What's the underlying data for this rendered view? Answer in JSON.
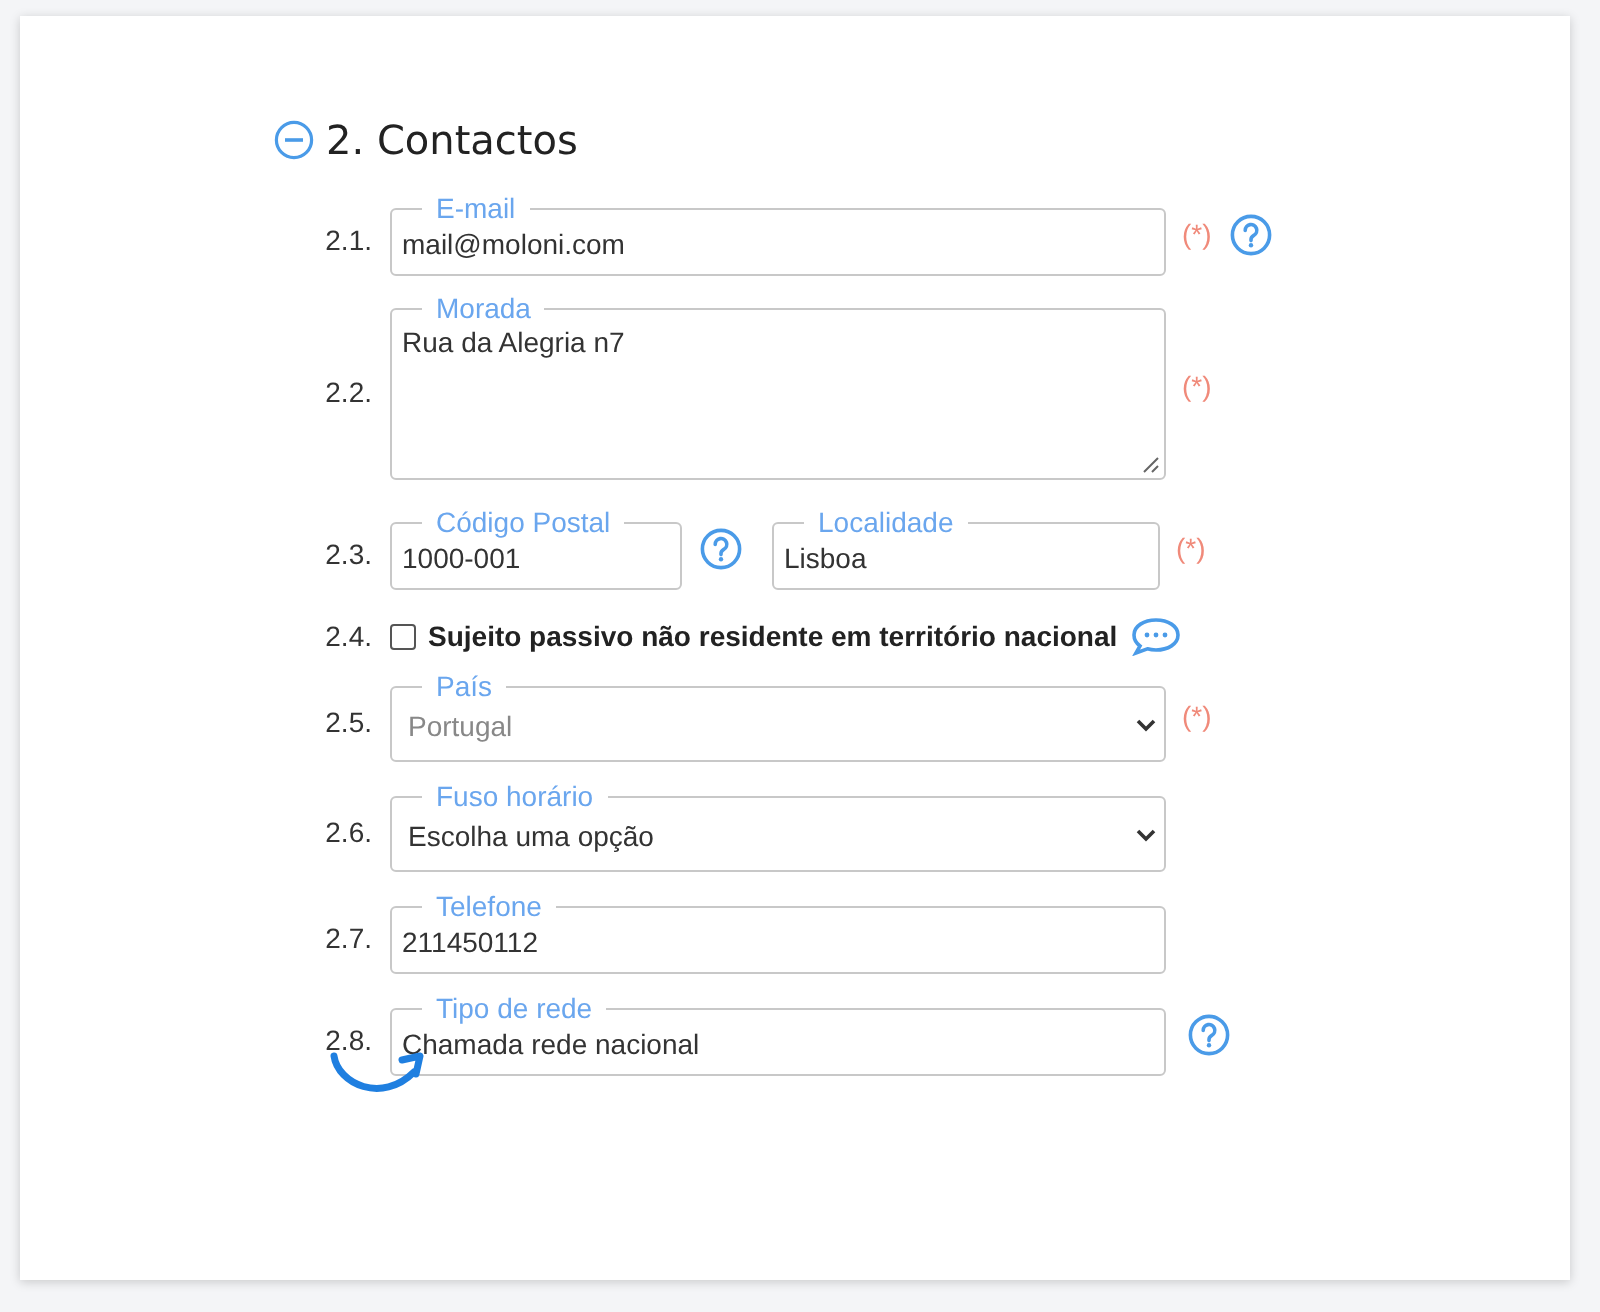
{
  "section": {
    "title": "2. Contactos",
    "expanded": true
  },
  "rows": [
    {
      "kind": "input",
      "number": "2.1.",
      "label": "E-mail",
      "value": "mail@moloni.com",
      "required": "(*)",
      "help": true
    },
    {
      "kind": "textarea",
      "number": "2.2.",
      "label": "Morada",
      "value": "Rua da Alegria n7",
      "required": "(*)",
      "help": false
    },
    {
      "kind": "pair",
      "number": "2.3.",
      "label": "Código Postal",
      "value": "1000-001",
      "help": true,
      "second": {
        "label": "Localidade",
        "value": "Lisboa"
      },
      "required": "(*)"
    },
    {
      "kind": "checkbox",
      "number": "2.4.",
      "label": "Sujeito passivo não residente em território nacional",
      "checked": false,
      "comment": true
    },
    {
      "kind": "select",
      "number": "2.5.",
      "label": "País",
      "value": "Portugal",
      "disabled": true,
      "required": "(*)",
      "help": false
    },
    {
      "kind": "select",
      "number": "2.6.",
      "label": "Fuso horário",
      "value": "Escolha uma opção",
      "disabled": false,
      "help": false
    },
    {
      "kind": "input",
      "number": "2.7.",
      "label": "Telefone",
      "value": "211450112",
      "help": false
    },
    {
      "kind": "input",
      "number": "2.8.",
      "label": "Tipo de rede",
      "value": "Chamada rede nacional",
      "help": true,
      "pointer": true
    }
  ]
}
